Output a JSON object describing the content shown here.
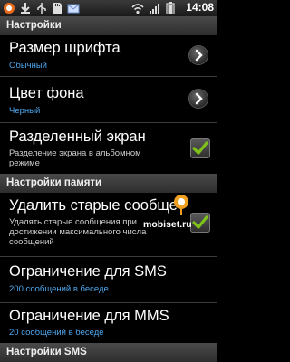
{
  "status_bar": {
    "time": "14:08",
    "icons": [
      "notification-icon",
      "download-icon",
      "usb-icon",
      "sd-card-icon",
      "mail-icon",
      "wifi-icon",
      "signal-icon",
      "battery-icon"
    ]
  },
  "sections": {
    "settings": {
      "title": "Настройки"
    },
    "memory": {
      "title": "Настройки памяти"
    },
    "sms": {
      "title": "Настройки SMS"
    }
  },
  "items": {
    "font_size": {
      "title": "Размер шрифта",
      "summary": "Обычный"
    },
    "bg_color": {
      "title": "Цвет фона",
      "summary": "Черный"
    },
    "split_screen": {
      "title": "Разделенный экран",
      "summary": "Разделение экрана в альбомном режиме",
      "checked": true
    },
    "delete_old": {
      "title": "Удалить старые сообще",
      "summary": "Удалять старые сообщения при достижении максимального числа сообщений",
      "checked": true
    },
    "sms_limit": {
      "title": "Ограничение для SMS",
      "summary": "200 сообщений в беседе"
    },
    "mms_limit": {
      "title": "Ограничение для MMS",
      "summary": "20 сообщений в беседе"
    }
  },
  "watermark": "mobiset.ru",
  "colors": {
    "accent": "#4fa8f0",
    "check": "#7ec21a",
    "background": "#000000"
  }
}
